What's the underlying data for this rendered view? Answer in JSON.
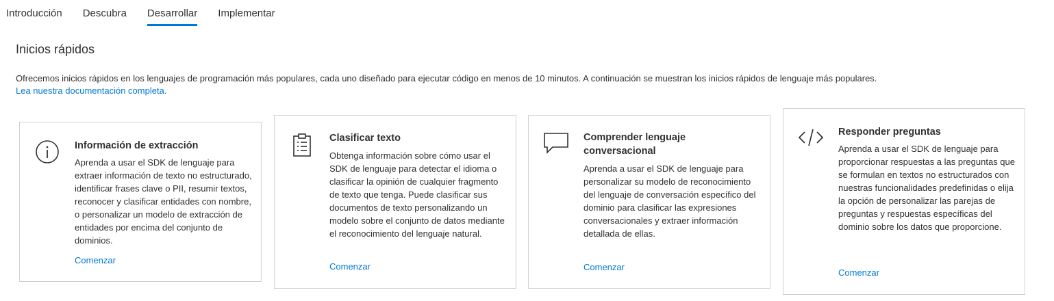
{
  "tabs": [
    {
      "label": "Introducción",
      "active": false
    },
    {
      "label": "Descubra",
      "active": false
    },
    {
      "label": "Desarrollar",
      "active": true
    },
    {
      "label": "Implementar",
      "active": false
    }
  ],
  "section": {
    "title": "Inicios rápidos",
    "description": "Ofrecemos inicios rápidos en los lenguajes de programación más populares, cada uno diseñado para ejecutar código en menos de 10 minutos. A continuación se muestran los inicios rápidos de lenguaje más populares.",
    "doc_link": "Lea nuestra documentación completa."
  },
  "cards": [
    {
      "icon": "info-circle-icon",
      "title": "Información de extracción",
      "description": "Aprenda a usar el SDK de lenguaje para extraer información de texto no estructurado, identificar frases clave o PII, resumir textos, reconocer y clasificar entidades con nombre, o personalizar un modelo de extracción de entidades por encima del conjunto de dominios.",
      "link": "Comenzar"
    },
    {
      "icon": "clipboard-list-icon",
      "title": "Clasificar texto",
      "description": "Obtenga información sobre cómo usar el SDK de lenguaje para detectar el idioma o clasificar la opinión de cualquier fragmento de texto que tenga. Puede clasificar sus documentos de texto personalizando un modelo sobre el conjunto de datos mediante el reconocimiento del lenguaje natural.",
      "link": "Comenzar"
    },
    {
      "icon": "chat-bubble-icon",
      "title": "Comprender lenguaje conversacional",
      "description": "Aprenda a usar el SDK de lenguaje para personalizar su modelo de reconocimiento del lenguaje de conversación específico del dominio para clasificar las expresiones conversacionales y extraer información detallada de ellas.",
      "link": "Comenzar"
    },
    {
      "icon": "code-icon",
      "title": "Responder preguntas",
      "description": "Aprenda a usar el SDK de lenguaje para proporcionar respuestas a las preguntas que se formulan en textos no estructurados con nuestras funcionalidades predefinidas o elija la opción de personalizar las parejas de preguntas y respuestas específicas del dominio sobre los datos que proporcione.",
      "link": "Comenzar"
    }
  ],
  "colors": {
    "accent": "#0078d4",
    "text": "#323130",
    "border": "#d2d0ce"
  }
}
